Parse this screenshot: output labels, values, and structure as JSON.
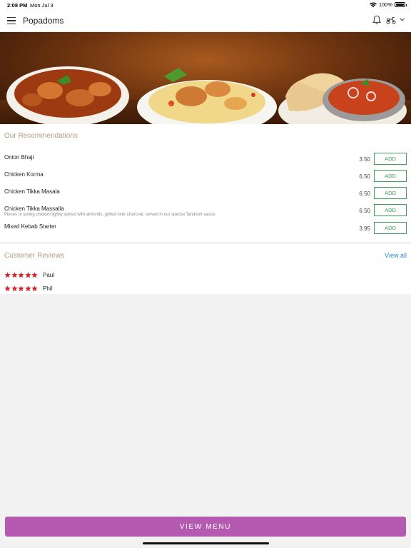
{
  "status_bar": {
    "time": "2:08 PM",
    "date": "Mon Jul 3",
    "battery": "100%"
  },
  "header": {
    "title": "Popadoms"
  },
  "icons": {
    "menu": "menu-icon",
    "bell": "bell-icon",
    "delivery": "scooter-icon",
    "chevron": "chevron-down-icon",
    "wifi": "wifi-icon",
    "star": "star-icon"
  },
  "colors": {
    "add_green": "#3aa356",
    "view_menu": "#b55ab1",
    "star_red": "#d9232a",
    "link_blue": "#2a8fc9",
    "section_tan": "#b29a82"
  },
  "recommendations": {
    "title": "Our Recommendations",
    "items": [
      {
        "name": "Onion Bhaji",
        "description": "",
        "price": "3.50",
        "button": "ADD"
      },
      {
        "name": "Chicken Korma",
        "description": "",
        "price": "6.50",
        "button": "ADD"
      },
      {
        "name": "Chicken Tikka Masala",
        "description": "",
        "price": "6.50",
        "button": "ADD"
      },
      {
        "name": "Chicken Tikka Massalla",
        "description": "Pieces of spring chicken lightly spiced with almonds, grilled over charcoal, served in our special Tandoori sauce.",
        "price": "6.50",
        "button": "ADD"
      },
      {
        "name": "Mixed Kebab Starter",
        "description": "",
        "price": "3.95",
        "button": "ADD"
      }
    ]
  },
  "reviews": {
    "title": "Customer Reviews",
    "view_all": "View all",
    "items": [
      {
        "name": "Paul",
        "stars": 5
      },
      {
        "name": "Phil",
        "stars": 5
      }
    ]
  },
  "footer": {
    "view_menu": "VIEW MENU"
  }
}
